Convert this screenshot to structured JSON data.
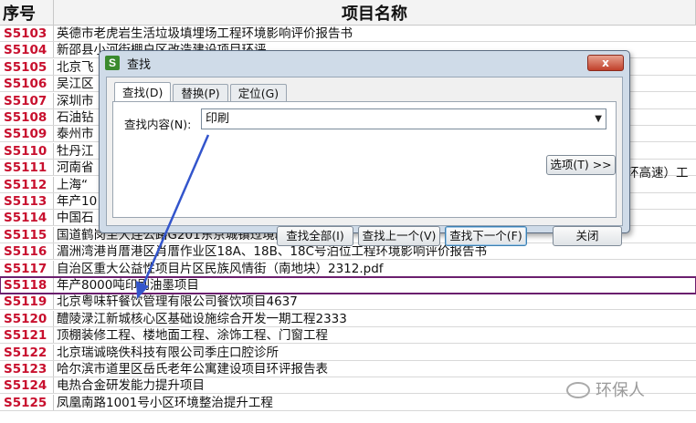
{
  "sheet": {
    "header_seq": "序号",
    "header_name": "项目名称",
    "rows": [
      {
        "id": "S5103",
        "name": "英德市老虎岩生活垃圾填埋场工程环境影响评价报告书"
      },
      {
        "id": "S5104",
        "name": "新邵县小河街棚户区改造建设项目环评"
      },
      {
        "id": "S5105",
        "name": "北京飞"
      },
      {
        "id": "S5106",
        "name": "吴江区"
      },
      {
        "id": "S5107",
        "name": "深圳市"
      },
      {
        "id": "S5108",
        "name": "石油钻"
      },
      {
        "id": "S5109",
        "name": "泰州市"
      },
      {
        "id": "S5110",
        "name": "牡丹江"
      },
      {
        "id": "S5111",
        "name": "河南省"
      },
      {
        "id": "S5112",
        "name": "上海“"
      },
      {
        "id": "S5113",
        "name": "年产10"
      },
      {
        "id": "S5114",
        "name": "中国石"
      },
      {
        "id": "S5115",
        "name": "国道鹤岗至大连公路G201东京城镇过境段改建工程"
      },
      {
        "id": "S5116",
        "name": "湄洲湾港肖厝港区肖厝作业区18A、18B、18C号泊位工程环境影响评价报告书"
      },
      {
        "id": "S5117",
        "name": "自治区重大公益性项目片区民族风情街（南地块）2312.pdf"
      },
      {
        "id": "S5118",
        "name": "年产8000吨印刷油墨项目"
      },
      {
        "id": "S5119",
        "name": "北京粤味轩餐饮管理有限公司餐饮项目4637"
      },
      {
        "id": "S5120",
        "name": "醴陵渌江新城核心区基础设施综合开发一期工程2333"
      },
      {
        "id": "S5121",
        "name": "顶棚装修工程、楼地面工程、涂饰工程、门窗工程"
      },
      {
        "id": "S5122",
        "name": "北京瑞诚晓佚科技有限公司季庄口腔诊所"
      },
      {
        "id": "S5123",
        "name": "哈尔滨市道里区岳氏老年公寓建设项目环评报告表"
      },
      {
        "id": "S5124",
        "name": "电热合金研发能力提升项目"
      },
      {
        "id": "S5125",
        "name": "凤凰南路1001号小区环境整治提升工程"
      }
    ],
    "selected_row_index": 15,
    "right_overflow_text": "环高速）工"
  },
  "dialog": {
    "app_icon_letter": "S",
    "title": "查找",
    "close_label": "x",
    "tabs": [
      "查找(D)",
      "替换(P)",
      "定位(G)"
    ],
    "active_tab_index": 0,
    "find_label": "查找内容(N):",
    "find_value": "印刷",
    "options_button": "选项(T) >>",
    "find_all_button": "查找全部(I)",
    "find_prev_button": "查找上一个(V)",
    "find_next_button": "查找下一个(F)",
    "close_button": "关闭"
  },
  "watermark": {
    "text": "环保人"
  },
  "colors": {
    "id_red": "#c8102e",
    "selection_border": "#6b1f6e",
    "arrow_blue": "#3355cc"
  }
}
